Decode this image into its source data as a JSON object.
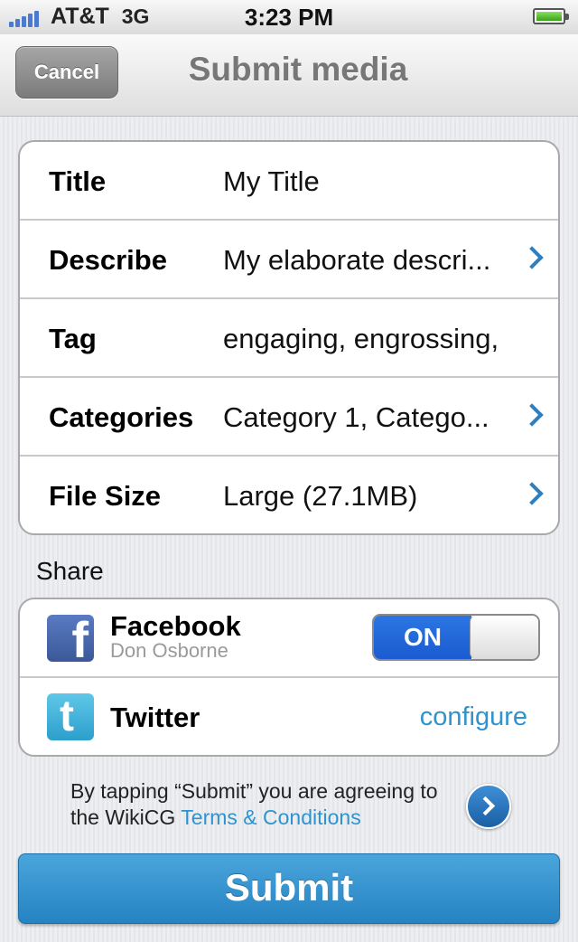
{
  "status_bar": {
    "carrier": "AT&T",
    "network": "3G",
    "time": "3:23 PM",
    "signal_bars": 5,
    "battery_icon": "battery-full-icon"
  },
  "nav": {
    "cancel_label": "Cancel",
    "title": "Submit media"
  },
  "form": {
    "rows": [
      {
        "label": "Title",
        "value": "My Title",
        "has_chevron": false
      },
      {
        "label": "Describe",
        "value": "My elaborate descri...",
        "has_chevron": true
      },
      {
        "label": "Tag",
        "value": "engaging, engrossing,",
        "has_chevron": false
      },
      {
        "label": "Categories",
        "value": "Category 1, Catego...",
        "has_chevron": true
      },
      {
        "label": "File Size",
        "value": "Large (27.1MB)",
        "has_chevron": true
      }
    ]
  },
  "share": {
    "heading": "Share",
    "facebook": {
      "icon": "facebook-icon",
      "icon_glyph": "f",
      "name": "Facebook",
      "account": "Don Osborne",
      "toggle_label": "ON",
      "enabled": true
    },
    "twitter": {
      "icon": "twitter-icon",
      "icon_glyph": "t",
      "name": "Twitter",
      "action": "configure"
    }
  },
  "terms": {
    "text": "By tapping “Submit” you are agreeing to the WikiCG ",
    "link": "Terms & Conditions"
  },
  "submit_label": "Submit",
  "colors": {
    "accent": "#2f93cf",
    "toggle_on": "#1a5bd1",
    "submit": "#2583c2"
  }
}
